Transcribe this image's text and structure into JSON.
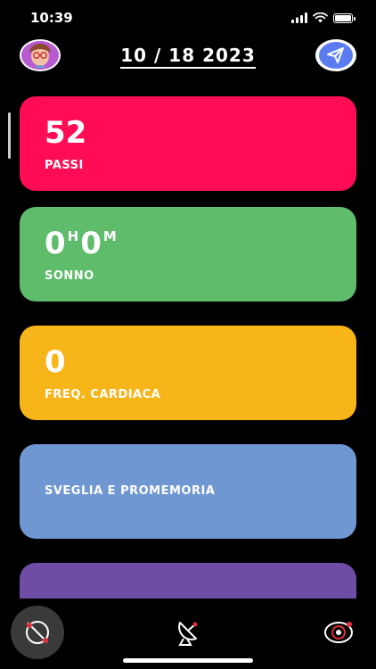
{
  "status_bar": {
    "time": "10:39"
  },
  "header": {
    "date": "10 / 18 2023"
  },
  "cards": {
    "steps": {
      "value": "52",
      "label": "PASSI"
    },
    "sleep": {
      "hours": "0",
      "hours_unit": "H",
      "minutes": "0",
      "minutes_unit": "M",
      "label": "SONNO"
    },
    "heart": {
      "value": "0",
      "label": "FREQ. CARDIACA"
    },
    "alarm": {
      "label": "SVEGLIA E PROMEMORIA"
    }
  },
  "colors": {
    "steps": "#ff0c55",
    "sleep": "#5fbc6b",
    "heart": "#f8b51a",
    "alarm": "#6f97d2",
    "extra": "#6f4da5"
  },
  "tab_bar": {
    "icons": [
      "activity-orbit-icon",
      "satellite-dish-icon",
      "target-eye-icon"
    ]
  }
}
